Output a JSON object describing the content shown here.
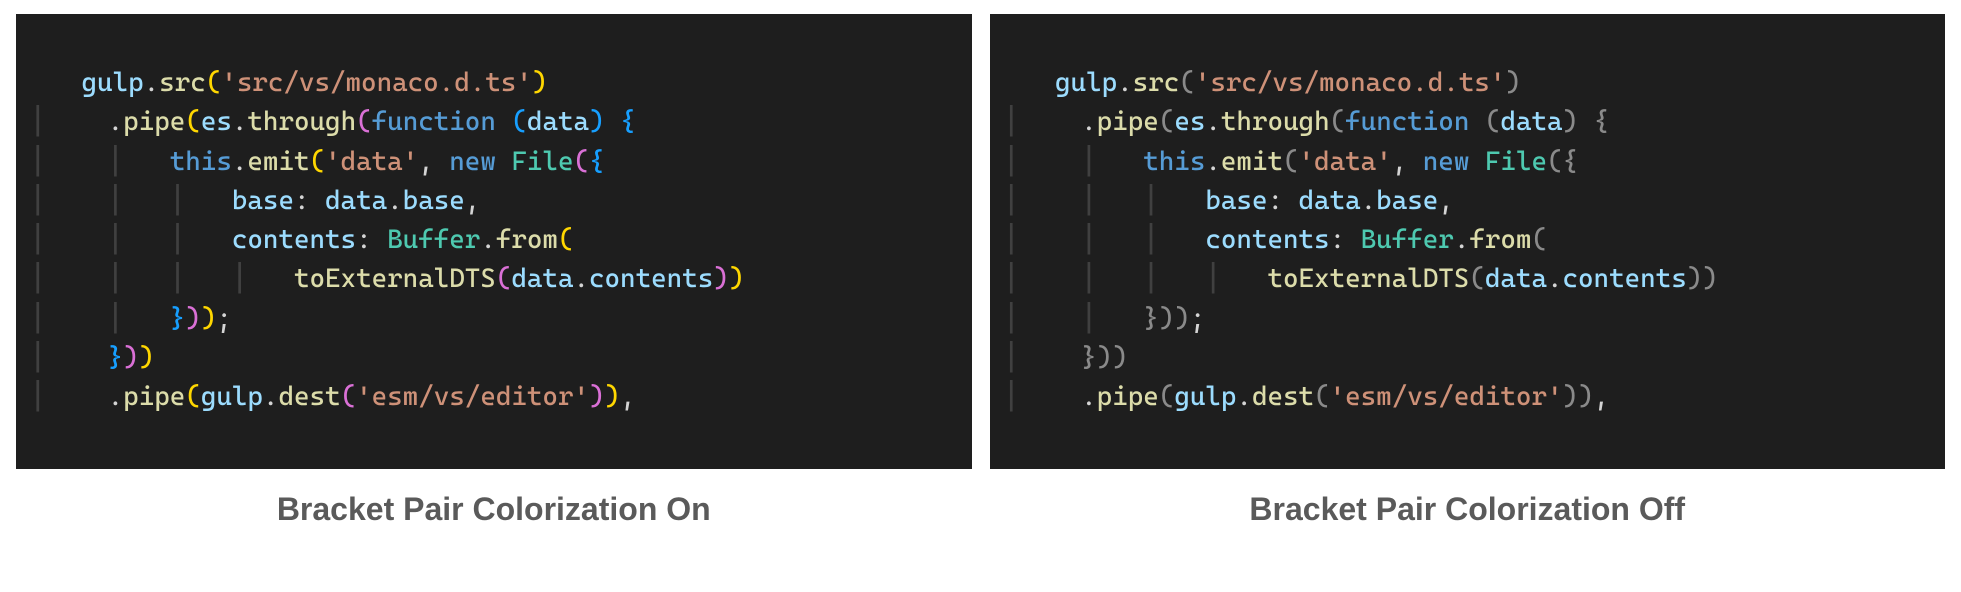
{
  "captions": {
    "left": "Bracket Pair Colorization On",
    "right": "Bracket Pair Colorization Off"
  },
  "code": {
    "line1": {
      "obj": "gulp",
      "method": "src",
      "arg": "'src/vs/monaco.d.ts'"
    },
    "line2": {
      "method": "pipe",
      "obj": "es",
      "method2": "through",
      "kw": "function",
      "param": "data"
    },
    "line3": {
      "this": "this",
      "method": "emit",
      "arg1": "'data'",
      "kw": "new",
      "class": "File"
    },
    "line4": {
      "key": "base",
      "obj": "data",
      "prop": "base"
    },
    "line5": {
      "key": "contents",
      "class": "Buffer",
      "method": "from"
    },
    "line6": {
      "fn": "toExternalDTS",
      "obj": "data",
      "prop": "contents"
    },
    "line9": {
      "method": "pipe",
      "obj": "gulp",
      "method2": "dest",
      "arg": "'esm/vs/editor'"
    }
  }
}
